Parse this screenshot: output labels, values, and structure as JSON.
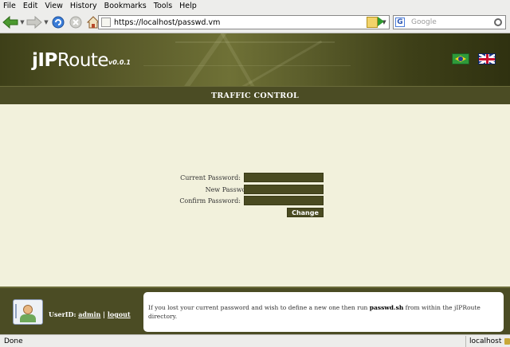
{
  "browser": {
    "menu": [
      "File",
      "Edit",
      "View",
      "History",
      "Bookmarks",
      "Tools",
      "Help"
    ],
    "url": "https://localhost/passwd.vm",
    "search_placeholder": "Google",
    "search_engine_letter": "G",
    "status": "Done",
    "status_host": "localhost"
  },
  "header": {
    "logo_bold": "jIP",
    "logo_rest": "Route",
    "version": "v0.0.1"
  },
  "section_title": "TRAFFIC CONTROL",
  "form": {
    "current_password_label": "Current Password:",
    "new_password_label": "New Password:",
    "confirm_password_label": "Confirm Password:",
    "change_button": "Change"
  },
  "footer": {
    "userid_label": "UserID:",
    "username": "admin",
    "separator": "|",
    "logout": "logout",
    "info_pre": "If you lost your current password and wish to define a new one then run ",
    "info_cmd": "passwd.sh",
    "info_post": " from within the jIPRoute directory."
  },
  "icons": {
    "back": "back-arrow-icon",
    "forward": "forward-arrow-icon",
    "reload": "reload-icon",
    "stop": "stop-icon",
    "home": "home-icon",
    "brazil_flag": "brazil-flag-icon",
    "uk_flag": "uk-flag-icon",
    "user": "user-avatar-icon"
  },
  "colors": {
    "accent_dark": "#4b4c24",
    "page_bg": "#f2f1dc"
  }
}
